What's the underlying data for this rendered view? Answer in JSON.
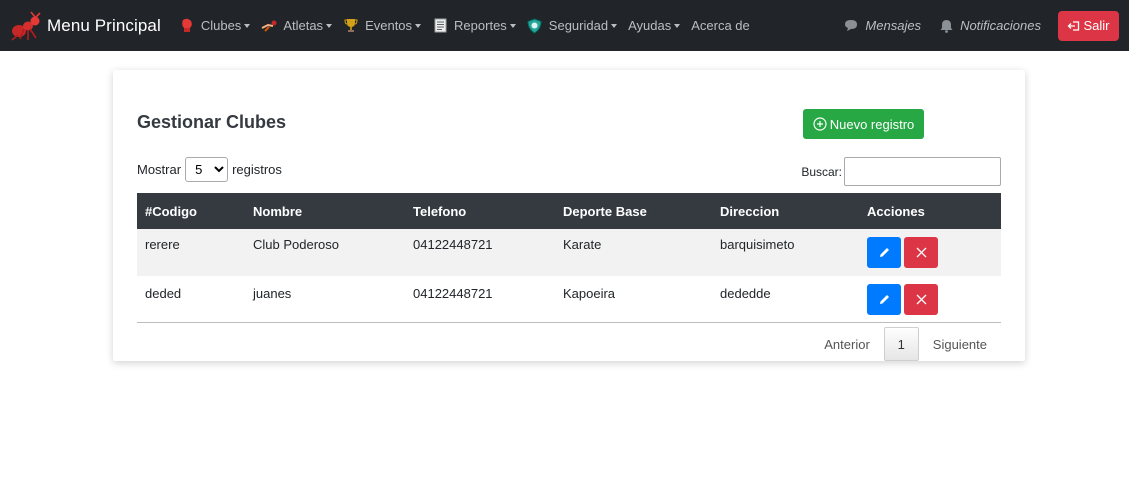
{
  "navbar": {
    "brand": "Menu Principal",
    "menus": [
      {
        "label": "Clubes",
        "icon": "boxing-glove-icon",
        "has_dropdown": true
      },
      {
        "label": "Atletas",
        "icon": "athlete-icon",
        "has_dropdown": true
      },
      {
        "label": "Eventos",
        "icon": "trophy-icon",
        "has_dropdown": true
      },
      {
        "label": "Reportes",
        "icon": "report-icon",
        "has_dropdown": true
      },
      {
        "label": "Seguridad",
        "icon": "shield-icon",
        "has_dropdown": true
      },
      {
        "label": "Ayudas",
        "icon": "",
        "has_dropdown": true
      },
      {
        "label": "Acerca de",
        "icon": "",
        "has_dropdown": false
      }
    ],
    "mensajes": "Mensajes",
    "notificaciones": "Notificaciones",
    "salir": "Salir"
  },
  "page": {
    "title": "Gestionar Clubes",
    "new_button": "Nuevo registro",
    "show_label": "Mostrar",
    "show_value": "5",
    "records_label": "registros",
    "search_label": "Buscar:",
    "search_value": ""
  },
  "table": {
    "columns": [
      "#Codigo",
      "Nombre",
      "Telefono",
      "Deporte Base",
      "Direccion",
      "Acciones"
    ],
    "rows": [
      [
        "rerere",
        "Club Poderoso",
        "04122448721",
        "Karate",
        "barquisimeto"
      ],
      [
        "deded",
        "juanes",
        "04122448721",
        "Kapoeira",
        "dededde"
      ]
    ]
  },
  "pagination": {
    "previous": "Anterior",
    "current": "1",
    "next": "Siguiente"
  },
  "colors": {
    "navbar_bg": "#212529",
    "success": "#28a745",
    "danger": "#dc3545",
    "primary": "#007bff",
    "table_header": "#343a40"
  }
}
